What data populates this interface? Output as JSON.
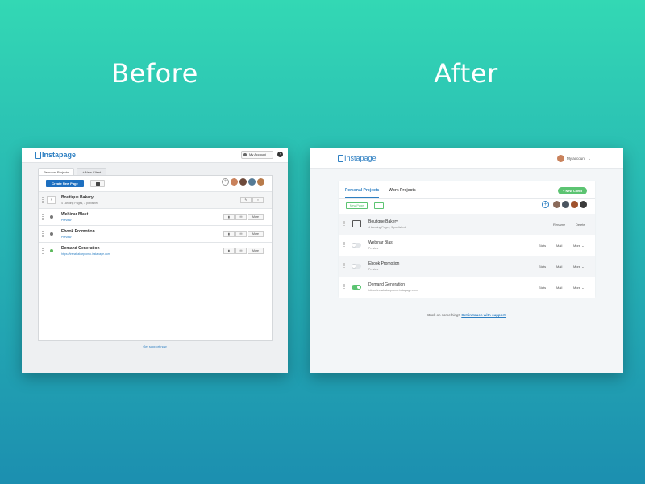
{
  "labels": {
    "before": "Before",
    "after": "After"
  },
  "before": {
    "logo": "Instapage",
    "account": "My Account",
    "help": "?",
    "tabs": [
      "Personal Projects",
      "+ New Client"
    ],
    "create_button": "Create New Page",
    "rows": [
      {
        "title": "Boutique Bakery",
        "sub": "4 Landing Pages, 3 published",
        "type": "folder"
      },
      {
        "title": "Webinar Blast",
        "sub": "Preview",
        "more": "More"
      },
      {
        "title": "Ebook Promotion",
        "sub": "Preview",
        "more": "More"
      },
      {
        "title": "Demand Generation",
        "sub": "https://trenzbakarpromo.instapage.com",
        "more": "More"
      }
    ],
    "support": "Get support now"
  },
  "after": {
    "logo": "Instapage",
    "account": "My account",
    "tabs": [
      "Personal Projects",
      "Work Projects"
    ],
    "new_client": "+ New Client",
    "new_page": "New Page",
    "rows": [
      {
        "title": "Boutique Bakery",
        "sub": "4 Landing Pages, 3 published",
        "a1": "Rename",
        "a2": "Delete"
      },
      {
        "title": "Webinar Blast",
        "sub": "Preview",
        "a1": "Stats",
        "a2": "Mail",
        "a3": "More"
      },
      {
        "title": "Ebook Promotion",
        "sub": "Preview",
        "a1": "Stats",
        "a2": "Mail",
        "a3": "More"
      },
      {
        "title": "Demand Generation",
        "sub": "https://trenzbakarpromo.instapage.com",
        "a1": "Stats",
        "a2": "Mail",
        "a3": "More"
      }
    ],
    "support_prefix": "Stuck on something?",
    "support_link": "Get in touch with support."
  },
  "colors": {
    "brand_blue": "#2d7fc2",
    "primary_button": "#1d6fc0",
    "accent_green": "#5cc472",
    "background_top": "#33d8b4",
    "background_bottom": "#1c8fb0"
  }
}
